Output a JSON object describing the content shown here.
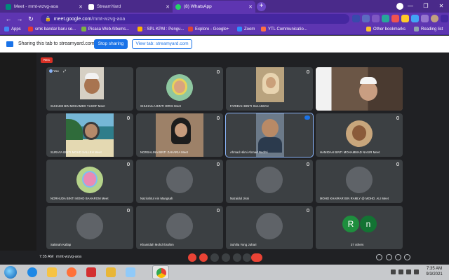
{
  "browser": {
    "tabs": [
      {
        "label": "Meet - mmt-wzvg-aoa",
        "favicon_color": "#00897b",
        "active": false
      },
      {
        "label": "StreamYard",
        "favicon_color": "#ffffff",
        "active": false
      },
      {
        "label": "(8) WhatsApp",
        "favicon_color": "#25d366",
        "active": true
      }
    ],
    "new_tab": "+",
    "address": {
      "host": "meet.google.com",
      "path": "/mmt-wzvg-aoa"
    },
    "window_controls": [
      "—",
      "❐",
      "✕"
    ],
    "bookmarks": [
      {
        "label": "Apps",
        "color": "#4285f4"
      },
      {
        "label": "smk bandar baru se...",
        "color": "#e53935"
      },
      {
        "label": "Picasa Web Albums...",
        "color": "#7cb342"
      },
      {
        "label": ": SPL KPM : Pengu...",
        "color": "#ffb300"
      },
      {
        "label": "Explore - Google+",
        "color": "#db4437"
      },
      {
        "label": "Zoom",
        "color": "#2d8cff"
      },
      {
        "label": "YTL Communicatio...",
        "color": "#ff7043"
      }
    ],
    "bookmarks_right": [
      {
        "label": "Other bookmarks",
        "color": "#fbc02d"
      },
      {
        "label": "Reading list",
        "color": "#90a4ae"
      }
    ]
  },
  "share_banner": {
    "text": "Sharing this tab to streamyard.com",
    "stop_label": "Stop sharing",
    "view_label": "View tab: streamyard.com"
  },
  "meeting": {
    "rec_label": "REC",
    "time": "7:35 AM",
    "code": "mmt-wzvg-aoa",
    "participants": [
      {
        "name": "SUHAIMI BIN MOHAMED YUSOF Meet",
        "kind": "photo",
        "bg": "#c8c3b8",
        "face": "#a87450",
        "you": "You"
      },
      {
        "name": "SHUHAILA BINTI IDRIS Meet",
        "kind": "avatar",
        "bg": "#3c4043",
        "face": "#8ec7a0"
      },
      {
        "name": "FARIDAH BINTI SULAIMAN",
        "kind": "photo",
        "bg": "#b9a37e",
        "face": "#caa07a"
      },
      {
        "name": "",
        "kind": "photo",
        "bg": "#8a6f59",
        "face": "#c99e82"
      },
      {
        "name": "SURAYA BINTI MOHD SALLEH Meet",
        "kind": "photo",
        "bg": "#3d8a9c",
        "face": "#b58a6a"
      },
      {
        "name": "NORSALINA BINTI ZAKARIA Meet",
        "kind": "photo",
        "bg": "#9d8168",
        "face": "#c79c7d"
      },
      {
        "name": "Ahmad Hilmi Ahmad Nadzri",
        "kind": "photo",
        "bg": "#6c7a89",
        "face": "#b98a66",
        "speaking": true
      },
      {
        "name": "HAMIDAH BINTI MOHAMMAD NASIR Meet",
        "kind": "avatar",
        "bg": "#3c4043",
        "face": "#c8a67c"
      },
      {
        "name": "NORHUDA BINTI MOHD BAHAROM Meet",
        "kind": "avatar",
        "bg": "#3c4043",
        "face": "#b5d38a"
      },
      {
        "name": "Nazirahtul Ain Mangsah",
        "kind": "avatar",
        "bg": "#3c4043",
        "face": "#5f6368"
      },
      {
        "name": "Nazaidul Jisni",
        "kind": "avatar",
        "bg": "#3c4043",
        "face": "#5f6368"
      },
      {
        "name": "MOHD KHAIRAR BIN RAMLY @ MOHD. ALI Meet",
        "kind": "avatar",
        "bg": "#3c4043",
        "face": "#5f6368"
      },
      {
        "name": "Sakinah Kallap",
        "kind": "avatar",
        "bg": "#3c4043",
        "face": "#5f6368"
      },
      {
        "name": "Khamidah Mohd Ibrahim",
        "kind": "avatar",
        "bg": "#3c4043",
        "face": "#5f6368"
      },
      {
        "name": "Suhilia Yong Juhari",
        "kind": "avatar",
        "bg": "#3c4043",
        "face": "#5f6368"
      },
      {
        "name": "37 others",
        "kind": "others",
        "bg": "#3c4043",
        "face": "#5f6368"
      }
    ],
    "others_letters": [
      "R",
      "n"
    ]
  },
  "taskbar": {
    "clock_time": "7:35 AM",
    "clock_date": "9/3/2021",
    "apps": [
      {
        "name": "ie",
        "color": "#1e88e5"
      },
      {
        "name": "explorer",
        "color": "#f6c343"
      },
      {
        "name": "firefox",
        "color": "#ff7139"
      },
      {
        "name": "media",
        "color": "#d32f2f"
      },
      {
        "name": "windows-explorer",
        "color": "#e8b637"
      },
      {
        "name": "notepad",
        "color": "#90caf9"
      },
      {
        "name": "chrome",
        "color": "#4caf50"
      }
    ]
  }
}
